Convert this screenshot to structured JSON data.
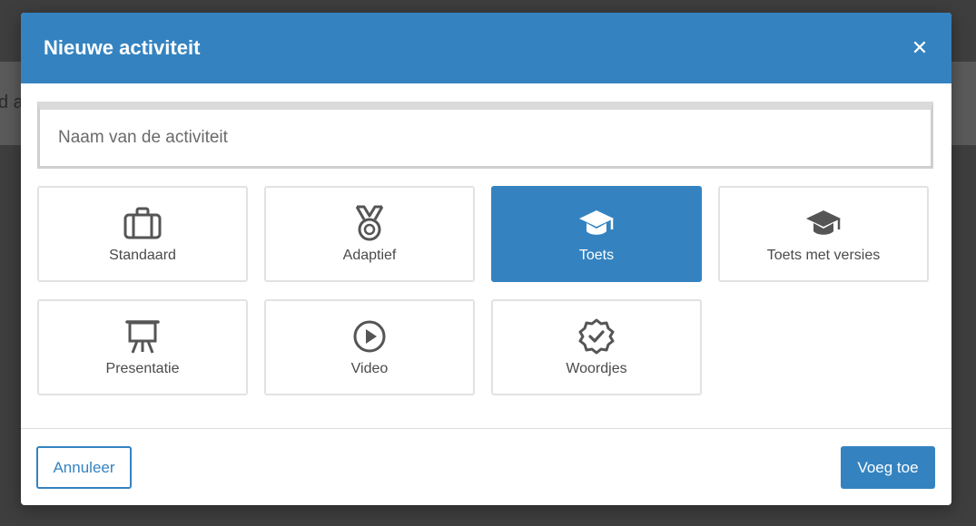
{
  "background": {
    "partial_text": "d a"
  },
  "modal": {
    "title": "Nieuwe activiteit",
    "close_glyph": "✕",
    "name_input": {
      "placeholder": "Naam van de activiteit",
      "value": ""
    },
    "tiles": [
      {
        "label": "Standaard",
        "icon": "briefcase-icon",
        "selected": false
      },
      {
        "label": "Adaptief",
        "icon": "medal-icon",
        "selected": false
      },
      {
        "label": "Toets",
        "icon": "graduation-cap-icon",
        "selected": true
      },
      {
        "label": "Toets met versies",
        "icon": "graduation-cap-icon",
        "selected": false
      },
      {
        "label": "Presentatie",
        "icon": "presentation-easel-icon",
        "selected": false
      },
      {
        "label": "Video",
        "icon": "play-circle-icon",
        "selected": false
      },
      {
        "label": "Woordjes",
        "icon": "badge-check-icon",
        "selected": false
      }
    ],
    "footer": {
      "cancel_label": "Annuleer",
      "add_label": "Voeg toe"
    }
  },
  "colors": {
    "accent": "#3483c0",
    "overlay": "#3e3e3e",
    "tile_border": "#e2e2e2",
    "icon": "#555555"
  }
}
